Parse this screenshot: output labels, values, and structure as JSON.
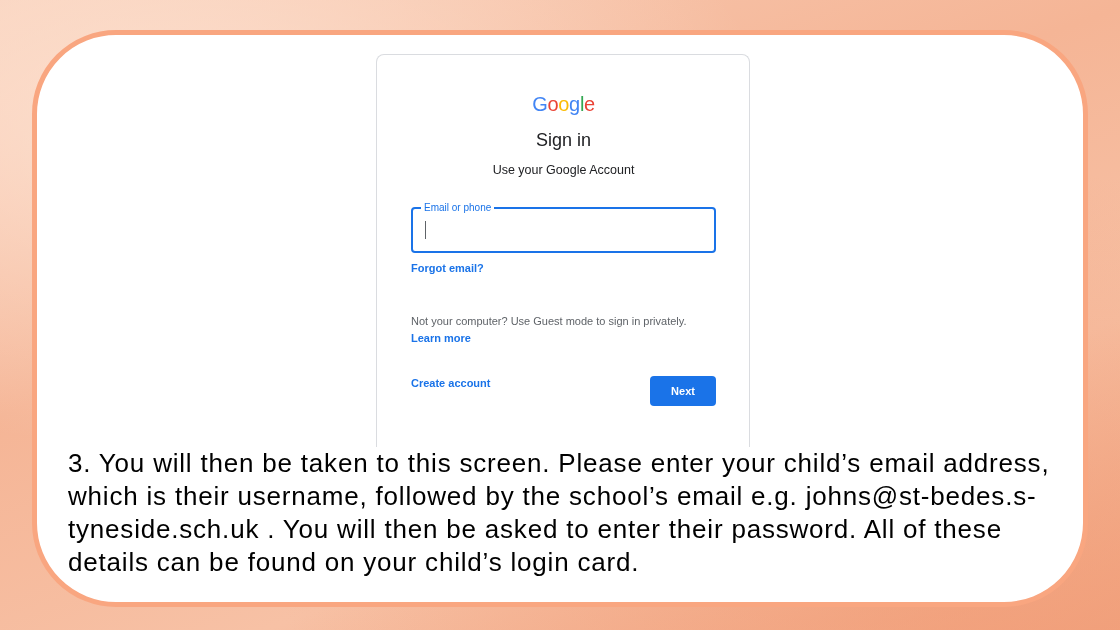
{
  "slide": {
    "sign_in_card": {
      "logo": "Google",
      "title": "Sign in",
      "subtitle": "Use your Google Account",
      "email_field": {
        "label": "Email or phone",
        "focused": true
      },
      "forgot_link": "Forgot email?",
      "guest_note": "Not your computer? Use Guest mode to sign in privately.",
      "learn_more_link": "Learn more",
      "create_account_link": "Create account",
      "next_button": "Next"
    },
    "instruction": "3. You will then be taken to this screen. Please enter your child’s email address, which is their username, followed by the school’s email e.g. johns@st-bedes.s-tyneside.sch.uk . You will then be asked to enter their password. All of these details can be found on your child’s login card."
  }
}
